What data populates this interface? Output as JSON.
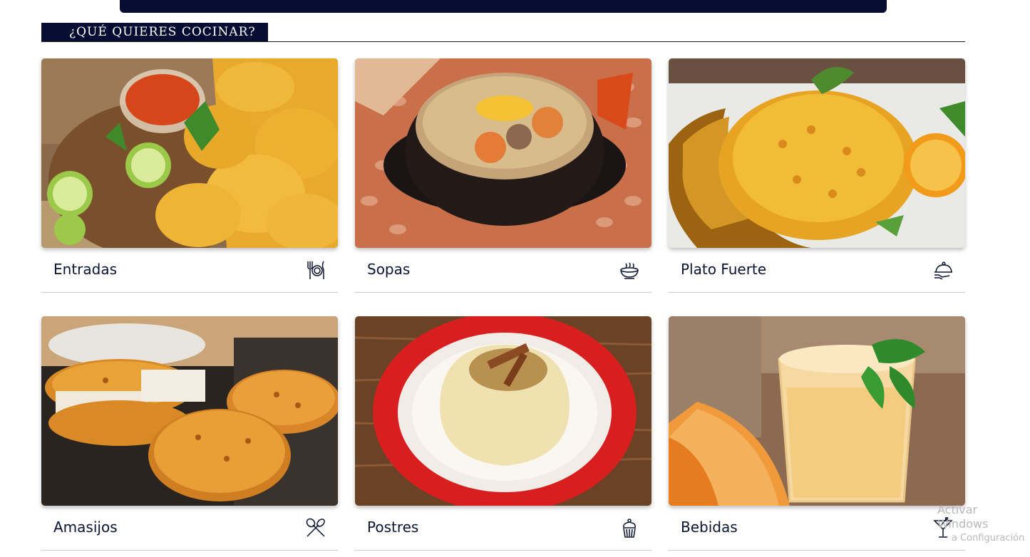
{
  "header": {
    "title": "¿QUÉ QUIERES COCINAR?"
  },
  "colors": {
    "navy": "#050d33",
    "text": "#0b1430"
  },
  "categories": [
    {
      "label": "Entradas",
      "icon": "utensils-plate-icon"
    },
    {
      "label": "Sopas",
      "icon": "soup-bowl-icon"
    },
    {
      "label": "Plato Fuerte",
      "icon": "serving-cloche-icon"
    },
    {
      "label": "Amasijos",
      "icon": "whisk-spoon-icon"
    },
    {
      "label": "Postres",
      "icon": "cupcake-icon"
    },
    {
      "label": "Bebidas",
      "icon": "cocktail-glass-icon"
    }
  ],
  "watermark": {
    "line1": "Activar Windows",
    "line2": "a Configuración"
  }
}
